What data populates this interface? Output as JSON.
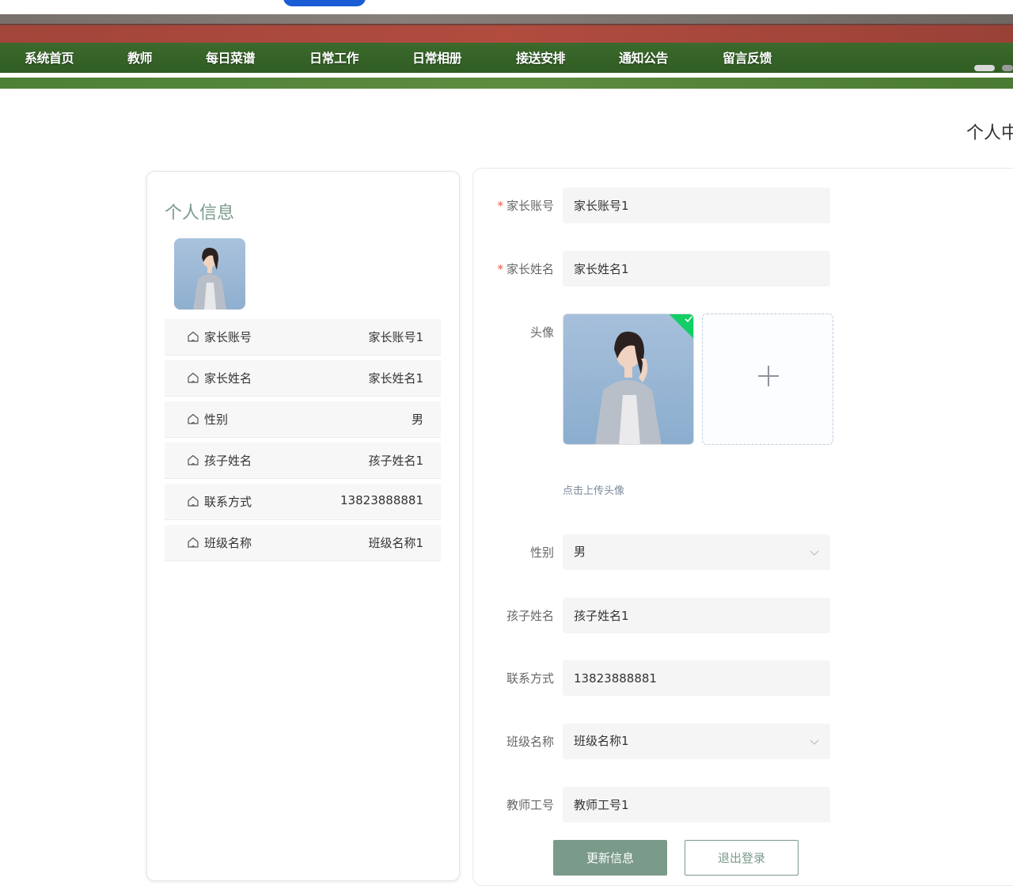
{
  "nav": {
    "items": [
      {
        "label": "系统首页"
      },
      {
        "label": "教师"
      },
      {
        "label": "每日菜谱"
      },
      {
        "label": "日常工作"
      },
      {
        "label": "日常相册"
      },
      {
        "label": "接送安排"
      },
      {
        "label": "通知公告"
      },
      {
        "label": "留言反馈"
      }
    ]
  },
  "page": {
    "title": "个人中"
  },
  "profile": {
    "title": "个人信息",
    "avatar_icon": "portrait-photo",
    "rows": [
      {
        "label": "家长账号",
        "value": "家长账号1"
      },
      {
        "label": "家长姓名",
        "value": "家长姓名1"
      },
      {
        "label": "性别",
        "value": "男"
      },
      {
        "label": "孩子姓名",
        "value": "孩子姓名1"
      },
      {
        "label": "联系方式",
        "value": "13823888881"
      },
      {
        "label": "班级名称",
        "value": "班级名称1"
      }
    ],
    "row_icon": "house-icon"
  },
  "form": {
    "account": {
      "label": "家长账号",
      "value": "家长账号1"
    },
    "name": {
      "label": "家长姓名",
      "value": "家长姓名1"
    },
    "avatar": {
      "label": "头像",
      "tip": "点击上传头像"
    },
    "gender": {
      "label": "性别",
      "value": "男"
    },
    "child": {
      "label": "孩子姓名",
      "value": "孩子姓名1"
    },
    "phone": {
      "label": "联系方式",
      "value": "13823888881"
    },
    "class": {
      "label": "班级名称",
      "value": "班级名称1"
    },
    "teacher": {
      "label": "教师工号",
      "value": "教师工号1"
    },
    "required_mark": "*",
    "update_label": "更新信息",
    "logout_label": "退出登录"
  },
  "colors": {
    "accent": "#7a9a8a",
    "success": "#13ce66",
    "required": "#e9573f"
  }
}
